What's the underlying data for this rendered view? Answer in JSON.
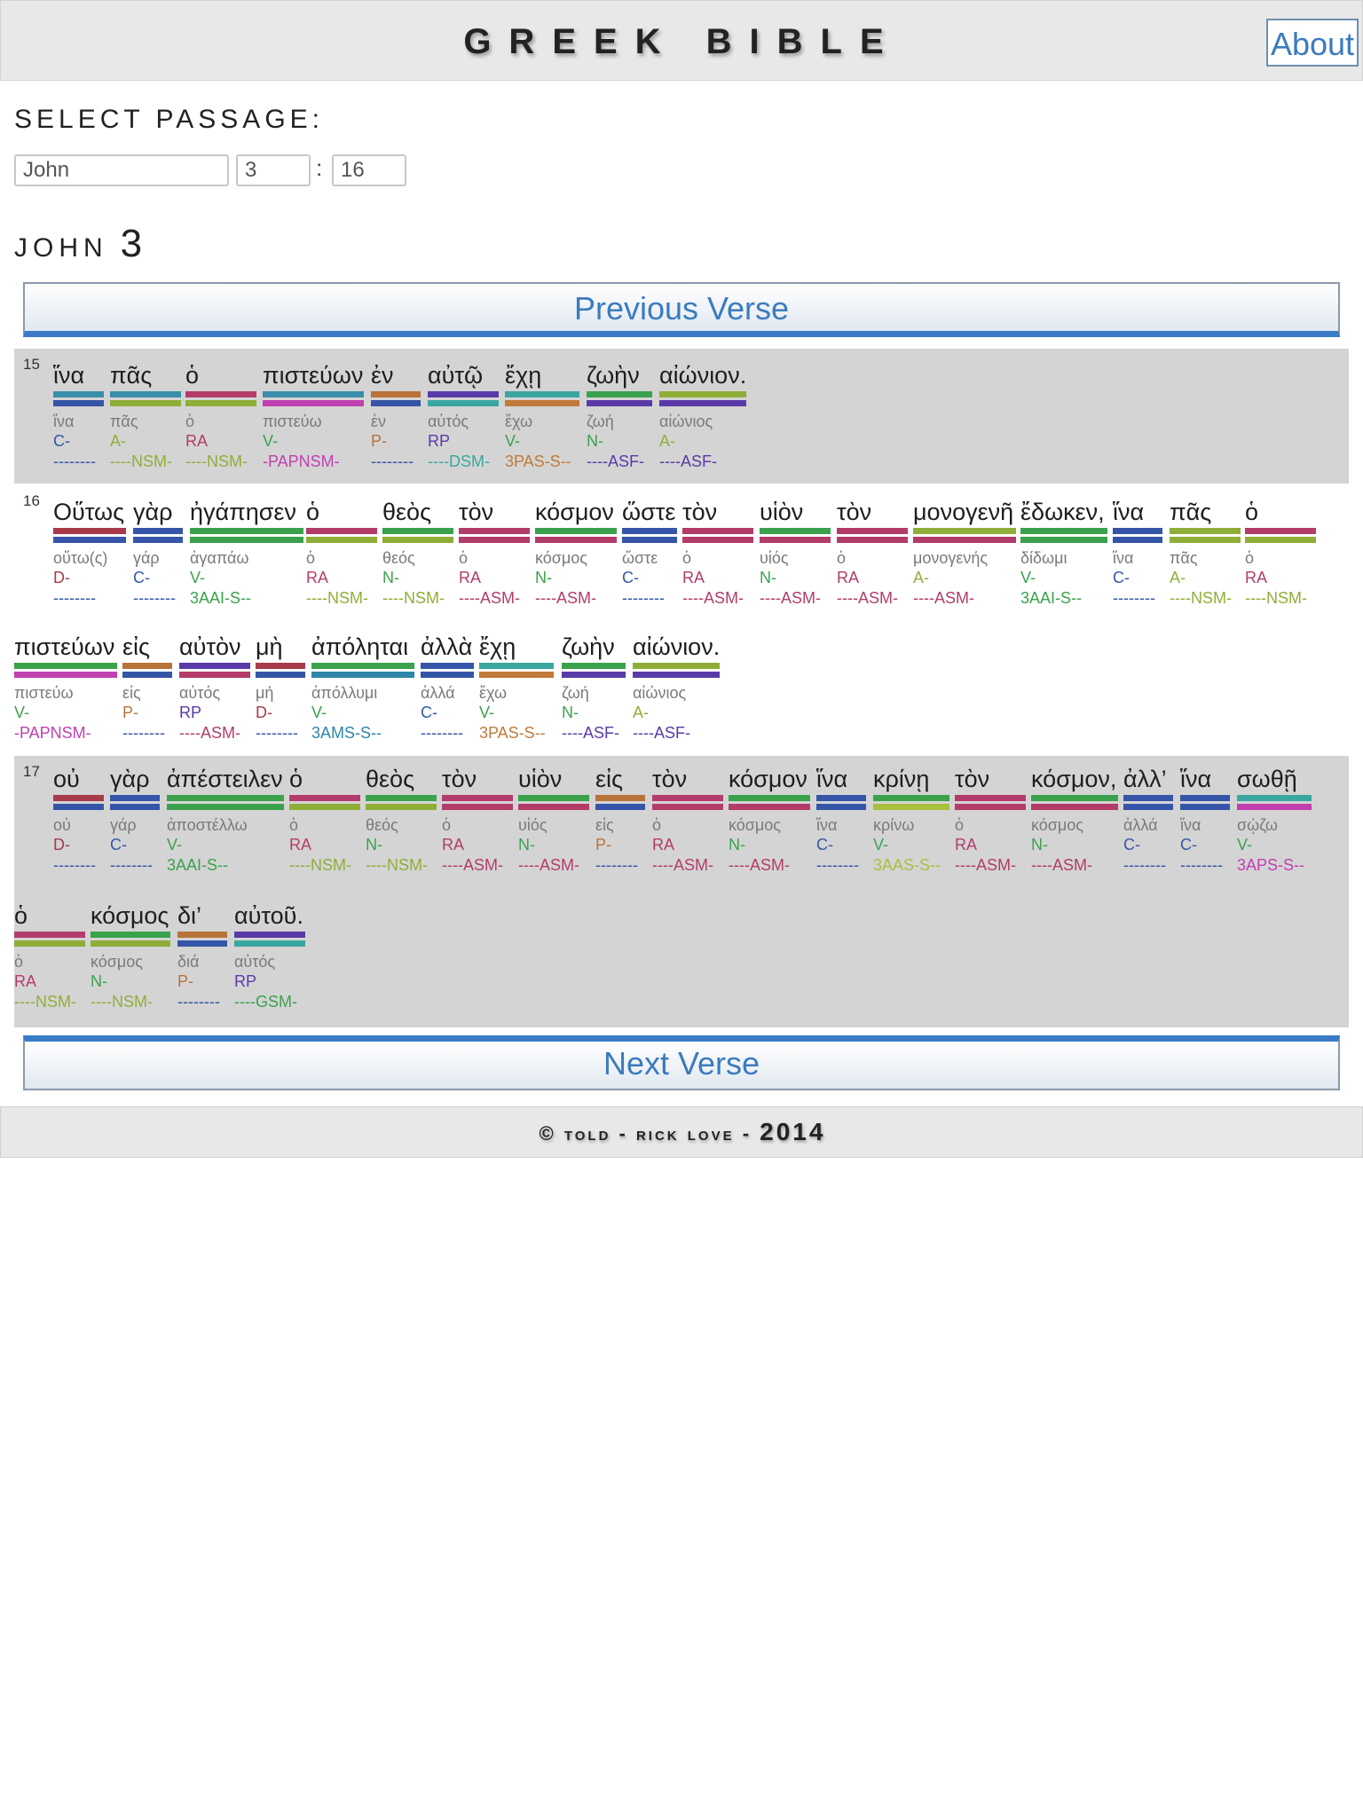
{
  "header": {
    "title": "GREEK BIBLE",
    "about_label": "About"
  },
  "passage": {
    "label": "SELECT PASSAGE:",
    "book": "John",
    "chapter": "3",
    "separator": ":",
    "verse": "16"
  },
  "chapter_heading": {
    "book": "JOHN",
    "chapter": "3"
  },
  "nav": {
    "prev_label": "Previous Verse",
    "next_label": "Next Verse"
  },
  "footer": {
    "text": "© told - rick love - ",
    "year": "2014"
  },
  "colors": {
    "conj": "#3556a8",
    "adj": "#8fae38",
    "art": "#b33c6a",
    "verb": "#3aa24c",
    "noun": "#3aa24c",
    "prep": "#b8733a",
    "pron": "#5a3aa8",
    "inf": "#c040b0",
    "dsm": "#3aa6a0",
    "v3pas": "#c07a3a",
    "v3ams": "#2e86a8",
    "v3aas": "#a8c040",
    "adv": "#a83a4a",
    "d_pos": "#a83a4a",
    "c_pos": "#3556a8",
    "gsm": "#3aa24c"
  },
  "verses": [
    {
      "number": "15",
      "tokens": [
        {
          "word": "ἵνα",
          "lemma": "ἵνα",
          "pos": "C-",
          "parse": "--------",
          "c1": "#3a8ea8",
          "c2": "#3556a8",
          "pc": "#3556a8",
          "qc": "#3556a8"
        },
        {
          "word": "πᾶς",
          "lemma": "πᾶς",
          "pos": "A-",
          "parse": "----NSM-",
          "c1": "#3a8ea8",
          "c2": "#8fae38",
          "pc": "#8fae38",
          "qc": "#8fae38"
        },
        {
          "word": "ὁ",
          "lemma": "ὁ",
          "pos": "RA",
          "parse": "----NSM-",
          "c1": "#b33c6a",
          "c2": "#8fae38",
          "pc": "#b33c6a",
          "qc": "#8fae38"
        },
        {
          "word": "πιστεύων",
          "lemma": "πιστεύω",
          "pos": "V-",
          "parse": "-PAPNSM-",
          "c1": "#3a8ea8",
          "c2": "#c040b0",
          "pc": "#3aa24c",
          "qc": "#c040b0"
        },
        {
          "word": "ἐν",
          "lemma": "ἐν",
          "pos": "P-",
          "parse": "--------",
          "c1": "#b8733a",
          "c2": "#3556a8",
          "pc": "#b8733a",
          "qc": "#3556a8"
        },
        {
          "word": "αὐτῷ",
          "lemma": "αὐτός",
          "pos": "RP",
          "parse": "----DSM-",
          "c1": "#5a3aa8",
          "c2": "#3aa6a0",
          "pc": "#5a3aa8",
          "qc": "#3aa6a0"
        },
        {
          "word": "ἔχῃ",
          "lemma": "ἔχω",
          "pos": "V-",
          "parse": "3PAS-S--",
          "c1": "#3aa6a0",
          "c2": "#c07a3a",
          "pc": "#3aa24c",
          "qc": "#c07a3a"
        },
        {
          "word": "ζωὴν",
          "lemma": "ζωή",
          "pos": "N-",
          "parse": "----ASF-",
          "c1": "#3aa24c",
          "c2": "#5a3aa8",
          "pc": "#3aa24c",
          "qc": "#5a3aa8"
        },
        {
          "word": "αἰώνιον.",
          "lemma": "αἰώνιος",
          "pos": "A-",
          "parse": "----ASF-",
          "c1": "#8fae38",
          "c2": "#5a3aa8",
          "pc": "#8fae38",
          "qc": "#5a3aa8"
        }
      ]
    },
    {
      "number": "16",
      "tokens": [
        {
          "word": "Οὕτως",
          "lemma": "οὕτω(ς)",
          "pos": "D-",
          "parse": "--------",
          "c1": "#a83a4a",
          "c2": "#3556a8",
          "pc": "#a83a4a",
          "qc": "#3556a8"
        },
        {
          "word": "γὰρ",
          "lemma": "γάρ",
          "pos": "C-",
          "parse": "--------",
          "c1": "#3556a8",
          "c2": "#3556a8",
          "pc": "#3556a8",
          "qc": "#3556a8"
        },
        {
          "word": "ἠγάπησεν",
          "lemma": "ἀγαπάω",
          "pos": "V-",
          "parse": "3AAI-S--",
          "c1": "#3aa24c",
          "c2": "#3aa24c",
          "pc": "#3aa24c",
          "qc": "#3aa24c"
        },
        {
          "word": "ὁ",
          "lemma": "ὁ",
          "pos": "RA",
          "parse": "----NSM-",
          "c1": "#b33c6a",
          "c2": "#8fae38",
          "pc": "#b33c6a",
          "qc": "#8fae38"
        },
        {
          "word": "θεὸς",
          "lemma": "θεός",
          "pos": "N-",
          "parse": "----NSM-",
          "c1": "#3aa24c",
          "c2": "#8fae38",
          "pc": "#3aa24c",
          "qc": "#8fae38"
        },
        {
          "word": "τὸν",
          "lemma": "ὁ",
          "pos": "RA",
          "parse": "----ASM-",
          "c1": "#b33c6a",
          "c2": "#b33c6a",
          "pc": "#b33c6a",
          "qc": "#b33c6a"
        },
        {
          "word": "κόσμον",
          "lemma": "κόσμος",
          "pos": "N-",
          "parse": "----ASM-",
          "c1": "#3aa24c",
          "c2": "#b33c6a",
          "pc": "#3aa24c",
          "qc": "#b33c6a"
        },
        {
          "word": "ὥστε",
          "lemma": "ὥστε",
          "pos": "C-",
          "parse": "--------",
          "c1": "#3556a8",
          "c2": "#3556a8",
          "pc": "#3556a8",
          "qc": "#3556a8"
        },
        {
          "word": "τὸν",
          "lemma": "ὁ",
          "pos": "RA",
          "parse": "----ASM-",
          "c1": "#b33c6a",
          "c2": "#b33c6a",
          "pc": "#b33c6a",
          "qc": "#b33c6a"
        },
        {
          "word": "υἱὸν",
          "lemma": "υἱός",
          "pos": "N-",
          "parse": "----ASM-",
          "c1": "#3aa24c",
          "c2": "#b33c6a",
          "pc": "#3aa24c",
          "qc": "#b33c6a"
        },
        {
          "word": "τὸν",
          "lemma": "ὁ",
          "pos": "RA",
          "parse": "----ASM-",
          "c1": "#b33c6a",
          "c2": "#b33c6a",
          "pc": "#b33c6a",
          "qc": "#b33c6a"
        },
        {
          "word": "μονογενῆ",
          "lemma": "μονογενής",
          "pos": "A-",
          "parse": "----ASM-",
          "c1": "#8fae38",
          "c2": "#b33c6a",
          "pc": "#8fae38",
          "qc": "#b33c6a"
        },
        {
          "word": "ἔδωκεν,",
          "lemma": "δίδωμι",
          "pos": "V-",
          "parse": "3AAI-S--",
          "c1": "#3aa24c",
          "c2": "#3aa24c",
          "pc": "#3aa24c",
          "qc": "#3aa24c"
        },
        {
          "word": "ἵνα",
          "lemma": "ἵνα",
          "pos": "C-",
          "parse": "--------",
          "c1": "#3556a8",
          "c2": "#3556a8",
          "pc": "#3556a8",
          "qc": "#3556a8"
        },
        {
          "word": "πᾶς",
          "lemma": "πᾶς",
          "pos": "A-",
          "parse": "----NSM-",
          "c1": "#8fae38",
          "c2": "#8fae38",
          "pc": "#8fae38",
          "qc": "#8fae38"
        },
        {
          "word": "ὁ",
          "lemma": "ὁ",
          "pos": "RA",
          "parse": "----NSM-",
          "c1": "#b33c6a",
          "c2": "#8fae38",
          "pc": "#b33c6a",
          "qc": "#8fae38"
        },
        {
          "word": "πιστεύων",
          "lemma": "πιστεύω",
          "pos": "V-",
          "parse": "-PAPNSM-",
          "c1": "#3aa24c",
          "c2": "#c040b0",
          "pc": "#3aa24c",
          "qc": "#c040b0"
        },
        {
          "word": "εἰς",
          "lemma": "εἰς",
          "pos": "P-",
          "parse": "--------",
          "c1": "#b8733a",
          "c2": "#3556a8",
          "pc": "#b8733a",
          "qc": "#3556a8"
        },
        {
          "word": "αὐτὸν",
          "lemma": "αὐτός",
          "pos": "RP",
          "parse": "----ASM-",
          "c1": "#5a3aa8",
          "c2": "#b33c6a",
          "pc": "#5a3aa8",
          "qc": "#b33c6a"
        },
        {
          "word": "μὴ",
          "lemma": "μή",
          "pos": "D-",
          "parse": "--------",
          "c1": "#a83a4a",
          "c2": "#3556a8",
          "pc": "#a83a4a",
          "qc": "#3556a8"
        },
        {
          "word": "ἀπόληται",
          "lemma": "ἀπόλλυμι",
          "pos": "V-",
          "parse": "3AMS-S--",
          "c1": "#3aa24c",
          "c2": "#2e86a8",
          "pc": "#3aa24c",
          "qc": "#2e86a8"
        },
        {
          "word": "ἀλλὰ",
          "lemma": "ἀλλά",
          "pos": "C-",
          "parse": "--------",
          "c1": "#3556a8",
          "c2": "#3556a8",
          "pc": "#3556a8",
          "qc": "#3556a8"
        },
        {
          "word": "ἔχῃ",
          "lemma": "ἔχω",
          "pos": "V-",
          "parse": "3PAS-S--",
          "c1": "#3aa6a0",
          "c2": "#c07a3a",
          "pc": "#3aa24c",
          "qc": "#c07a3a"
        },
        {
          "word": "ζωὴν",
          "lemma": "ζωή",
          "pos": "N-",
          "parse": "----ASF-",
          "c1": "#3aa24c",
          "c2": "#5a3aa8",
          "pc": "#3aa24c",
          "qc": "#5a3aa8"
        },
        {
          "word": "αἰώνιον.",
          "lemma": "αἰώνιος",
          "pos": "A-",
          "parse": "----ASF-",
          "c1": "#8fae38",
          "c2": "#5a3aa8",
          "pc": "#8fae38",
          "qc": "#5a3aa8"
        }
      ]
    },
    {
      "number": "17",
      "tokens": [
        {
          "word": "οὐ",
          "lemma": "οὐ",
          "pos": "D-",
          "parse": "--------",
          "c1": "#a83a4a",
          "c2": "#3556a8",
          "pc": "#a83a4a",
          "qc": "#3556a8"
        },
        {
          "word": "γὰρ",
          "lemma": "γάρ",
          "pos": "C-",
          "parse": "--------",
          "c1": "#3556a8",
          "c2": "#3556a8",
          "pc": "#3556a8",
          "qc": "#3556a8"
        },
        {
          "word": "ἀπέστειλεν",
          "lemma": "ἀποστέλλω",
          "pos": "V-",
          "parse": "3AAI-S--",
          "c1": "#3aa24c",
          "c2": "#3aa24c",
          "pc": "#3aa24c",
          "qc": "#3aa24c"
        },
        {
          "word": "ὁ",
          "lemma": "ὁ",
          "pos": "RA",
          "parse": "----NSM-",
          "c1": "#b33c6a",
          "c2": "#8fae38",
          "pc": "#b33c6a",
          "qc": "#8fae38"
        },
        {
          "word": "θεὸς",
          "lemma": "θεός",
          "pos": "N-",
          "parse": "----NSM-",
          "c1": "#3aa24c",
          "c2": "#8fae38",
          "pc": "#3aa24c",
          "qc": "#8fae38"
        },
        {
          "word": "τὸν",
          "lemma": "ὁ",
          "pos": "RA",
          "parse": "----ASM-",
          "c1": "#b33c6a",
          "c2": "#b33c6a",
          "pc": "#b33c6a",
          "qc": "#b33c6a"
        },
        {
          "word": "υἱὸν",
          "lemma": "υἱός",
          "pos": "N-",
          "parse": "----ASM-",
          "c1": "#3aa24c",
          "c2": "#b33c6a",
          "pc": "#3aa24c",
          "qc": "#b33c6a"
        },
        {
          "word": "εἰς",
          "lemma": "εἰς",
          "pos": "P-",
          "parse": "--------",
          "c1": "#b8733a",
          "c2": "#3556a8",
          "pc": "#b8733a",
          "qc": "#3556a8"
        },
        {
          "word": "τὸν",
          "lemma": "ὁ",
          "pos": "RA",
          "parse": "----ASM-",
          "c1": "#b33c6a",
          "c2": "#b33c6a",
          "pc": "#b33c6a",
          "qc": "#b33c6a"
        },
        {
          "word": "κόσμον",
          "lemma": "κόσμος",
          "pos": "N-",
          "parse": "----ASM-",
          "c1": "#3aa24c",
          "c2": "#b33c6a",
          "pc": "#3aa24c",
          "qc": "#b33c6a"
        },
        {
          "word": "ἵνα",
          "lemma": "ἵνα",
          "pos": "C-",
          "parse": "--------",
          "c1": "#3556a8",
          "c2": "#3556a8",
          "pc": "#3556a8",
          "qc": "#3556a8"
        },
        {
          "word": "κρίνῃ",
          "lemma": "κρίνω",
          "pos": "V-",
          "parse": "3AAS-S--",
          "c1": "#3aa24c",
          "c2": "#a8c040",
          "pc": "#3aa24c",
          "qc": "#a8c040"
        },
        {
          "word": "τὸν",
          "lemma": "ὁ",
          "pos": "RA",
          "parse": "----ASM-",
          "c1": "#b33c6a",
          "c2": "#b33c6a",
          "pc": "#b33c6a",
          "qc": "#b33c6a"
        },
        {
          "word": "κόσμον,",
          "lemma": "κόσμος",
          "pos": "N-",
          "parse": "----ASM-",
          "c1": "#3aa24c",
          "c2": "#b33c6a",
          "pc": "#3aa24c",
          "qc": "#b33c6a"
        },
        {
          "word": "ἀλλ’",
          "lemma": "ἀλλά",
          "pos": "C-",
          "parse": "--------",
          "c1": "#3556a8",
          "c2": "#3556a8",
          "pc": "#3556a8",
          "qc": "#3556a8"
        },
        {
          "word": "ἵνα",
          "lemma": "ἵνα",
          "pos": "C-",
          "parse": "--------",
          "c1": "#3556a8",
          "c2": "#3556a8",
          "pc": "#3556a8",
          "qc": "#3556a8"
        },
        {
          "word": "σωθῇ",
          "lemma": "σῴζω",
          "pos": "V-",
          "parse": "3APS-S--",
          "c1": "#3aa6a0",
          "c2": "#c040b0",
          "pc": "#3aa24c",
          "qc": "#c040b0"
        },
        {
          "word": "ὁ",
          "lemma": "ὁ",
          "pos": "RA",
          "parse": "----NSM-",
          "c1": "#b33c6a",
          "c2": "#8fae38",
          "pc": "#b33c6a",
          "qc": "#8fae38"
        },
        {
          "word": "κόσμος",
          "lemma": "κόσμος",
          "pos": "N-",
          "parse": "----NSM-",
          "c1": "#3aa24c",
          "c2": "#8fae38",
          "pc": "#3aa24c",
          "qc": "#8fae38"
        },
        {
          "word": "δι’",
          "lemma": "διά",
          "pos": "P-",
          "parse": "--------",
          "c1": "#b8733a",
          "c2": "#3556a8",
          "pc": "#b8733a",
          "qc": "#3556a8"
        },
        {
          "word": "αὐτοῦ.",
          "lemma": "αὐτός",
          "pos": "RP",
          "parse": "----GSM-",
          "c1": "#5a3aa8",
          "c2": "#3aa6a0",
          "pc": "#5a3aa8",
          "qc": "#3aa24c"
        }
      ]
    }
  ]
}
